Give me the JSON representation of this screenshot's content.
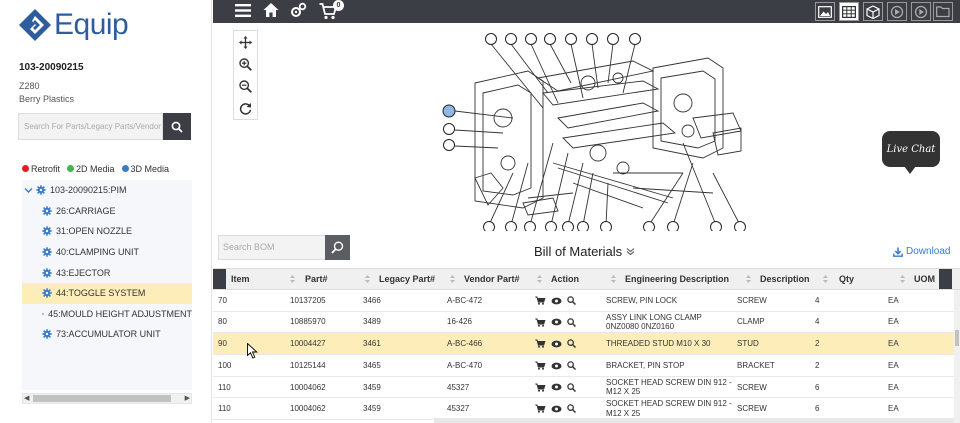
{
  "brand": {
    "name": "Equip"
  },
  "machine": {
    "id": "103-20090215",
    "model": "Z280",
    "customer": "Berry Plastics"
  },
  "sidebar_search": {
    "placeholder": "Search For Parts/Legacy Parts/Vendor"
  },
  "legend": [
    {
      "label": "Retrofit",
      "color": "#e02020"
    },
    {
      "label": "2D Media",
      "color": "#43b649"
    },
    {
      "label": "3D Media",
      "color": "#3a7bc8"
    }
  ],
  "tree": {
    "root": "103-20090215:PIM",
    "items": [
      {
        "label": "26:CARRIAGE"
      },
      {
        "label": "31:OPEN NOZZLE"
      },
      {
        "label": "40:CLAMPING UNIT"
      },
      {
        "label": "43:EJECTOR"
      },
      {
        "label": "44:TOGGLE SYSTEM",
        "selected": true
      },
      {
        "label": "45:MOULD HEIGHT ADJUSTMENT"
      },
      {
        "label": "73:ACCUMULATOR UNIT"
      }
    ]
  },
  "toolbar": {
    "cart_count": "0"
  },
  "viewer": {
    "live_chat": "Live Chat"
  },
  "bom": {
    "search_placeholder": "Search BOM",
    "title": "Bill of Materials",
    "download": "Download",
    "columns": [
      "Item",
      "Part#",
      "Legacy Part#",
      "Vendor Part#",
      "Action",
      "Engineering Description",
      "Description",
      "Qty",
      "UOM"
    ],
    "rows": [
      {
        "item": "70",
        "part": "10137205",
        "legacy": "3466",
        "vendor": "A-BC-472",
        "eng": "SCREW, PIN LOCK",
        "desc": "SCREW",
        "qty": "4",
        "uom": "EA"
      },
      {
        "item": "80",
        "part": "10885970",
        "legacy": "3489",
        "vendor": "16-426",
        "eng": "ASSY LINK LONG CLAMP 0NZ0080 0NZ0160",
        "desc": "CLAMP",
        "qty": "4",
        "uom": "EA"
      },
      {
        "item": "90",
        "part": "10004427",
        "legacy": "3461",
        "vendor": "A-BC-466",
        "eng": "THREADED STUD M10 X 30",
        "desc": "STUD",
        "qty": "2",
        "uom": "EA",
        "selected": true
      },
      {
        "item": "100",
        "part": "10125144",
        "legacy": "3465",
        "vendor": "A-BC-470",
        "eng": "BRACKET, PIN STOP",
        "desc": "BRACKET",
        "qty": "2",
        "uom": "EA"
      },
      {
        "item": "110",
        "part": "10004062",
        "legacy": "3459",
        "vendor": "45327",
        "eng": "SOCKET HEAD SCREW DIN 912 - M12 X 25",
        "desc": "SCREW",
        "qty": "6",
        "uom": "EA"
      },
      {
        "item": "110",
        "part": "10004062",
        "legacy": "3459",
        "vendor": "45327",
        "eng": "SOCKET HEAD SCREW DIN 912 - M12 X 25",
        "desc": "SCREW",
        "qty": "6",
        "uom": "EA"
      }
    ]
  }
}
